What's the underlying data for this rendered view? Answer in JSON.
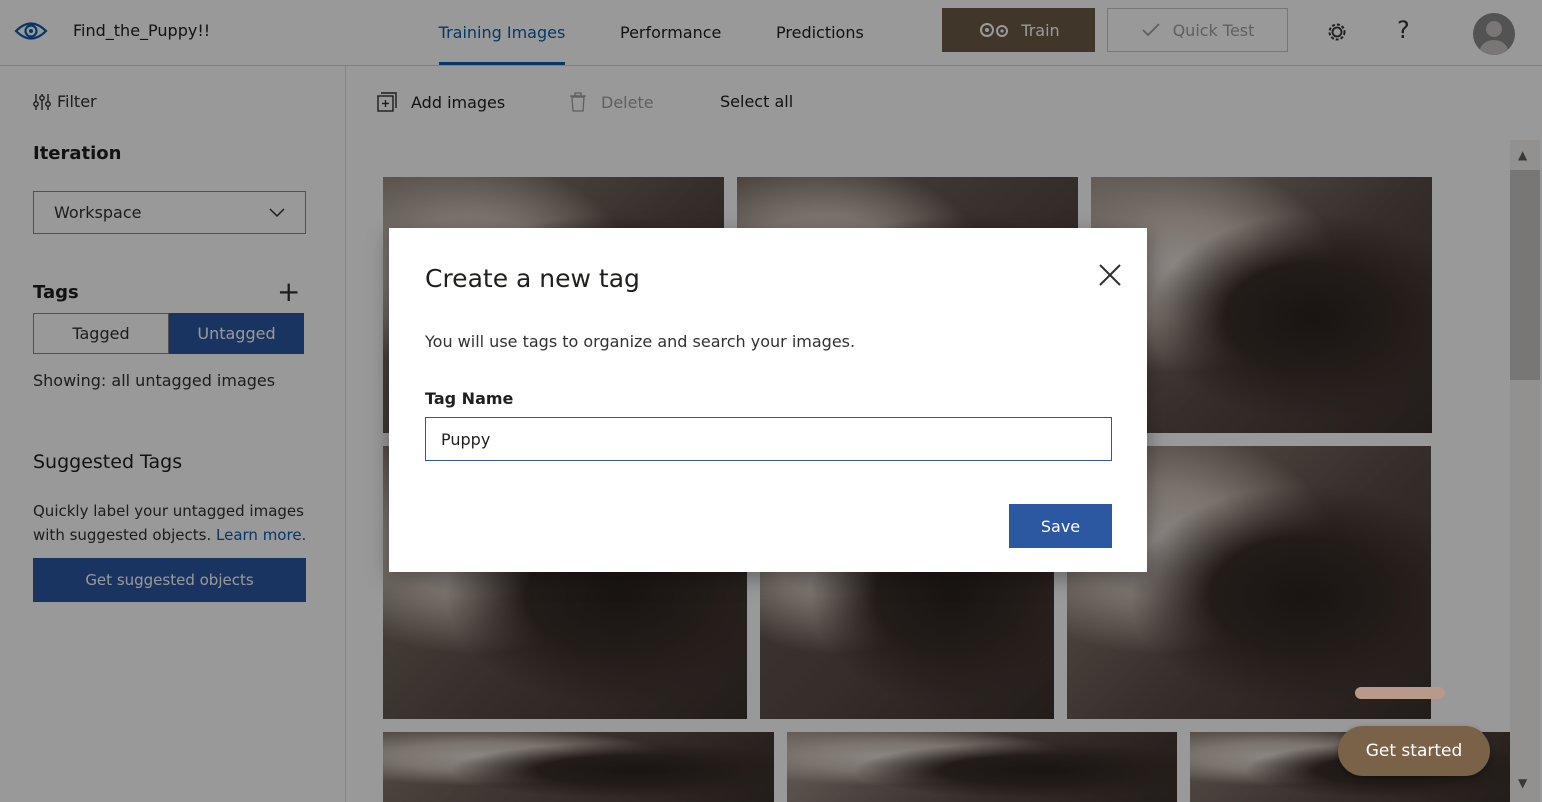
{
  "header": {
    "project_name": "Find_the_Puppy!!",
    "tabs": [
      {
        "label": "Training Images",
        "active": true
      },
      {
        "label": "Performance",
        "active": false
      },
      {
        "label": "Predictions",
        "active": false
      }
    ],
    "train_label": "Train",
    "quick_test_label": "Quick Test",
    "help_glyph": "?",
    "icons": {
      "logo": "eye-icon",
      "train": "gears-icon",
      "quick_test": "checkmark-icon",
      "settings": "gear-icon",
      "help": "help-icon",
      "avatar": "user-avatar"
    }
  },
  "sidebar": {
    "filter_label": "Filter",
    "iteration_heading": "Iteration",
    "iteration_value": "Workspace",
    "tags_heading": "Tags",
    "tag_filter": {
      "tagged": "Tagged",
      "untagged": "Untagged",
      "selected": "Untagged"
    },
    "showing_text": "Showing: all untagged images",
    "suggested_heading": "Suggested Tags",
    "suggested_desc": "Quickly label your untagged images with suggested objects.",
    "learn_more": "Learn more.",
    "suggested_button": "Get suggested objects"
  },
  "toolbar": {
    "add_images": "Add images",
    "delete": "Delete",
    "select_all": "Select all"
  },
  "gallery": {
    "images": [
      {
        "name": "puppy-photo-1",
        "tone": "#9a8a80"
      },
      {
        "name": "puppy-photo-2",
        "tone": "#7d6f68"
      },
      {
        "name": "puppy-photo-3",
        "tone": "#a69890"
      },
      {
        "name": "puppy-photo-4",
        "tone": "#8e7d74"
      },
      {
        "name": "puppy-photo-5",
        "tone": "#6e605a"
      },
      {
        "name": "puppy-photo-6",
        "tone": "#9f8f86"
      },
      {
        "name": "puppy-photo-7",
        "tone": "#8a7a72"
      },
      {
        "name": "puppy-photo-8",
        "tone": "#a89a93"
      },
      {
        "name": "puppy-photo-9",
        "tone": "#8f8079"
      }
    ]
  },
  "get_started_label": "Get started",
  "dialog": {
    "title": "Create a new tag",
    "description": "You will use tags to organize and search your images.",
    "tag_name_label": "Tag Name",
    "tag_name_value": "Puppy",
    "save_label": "Save"
  },
  "colors": {
    "accent_blue": "#2b58a0",
    "link_blue": "#0b5cad",
    "train_brown": "#6c5a46"
  }
}
